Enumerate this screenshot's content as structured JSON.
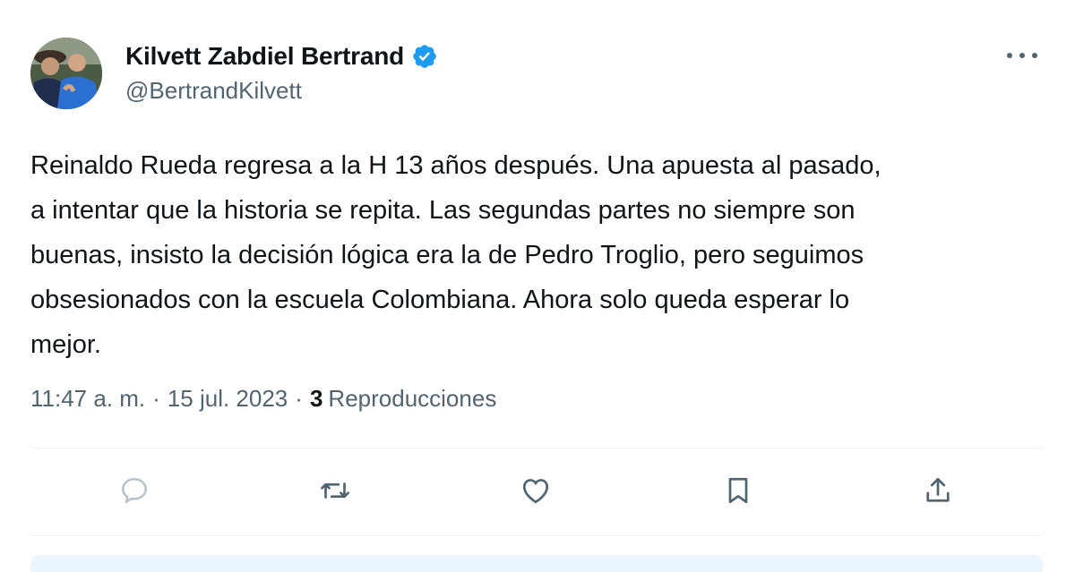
{
  "author": {
    "name": "Kilvett Zabdiel Bertrand",
    "handle": "@BertrandKilvett",
    "verified": true
  },
  "tweet": {
    "text": "Reinaldo Rueda regresa a la H 13 años después. Una apuesta al pasado,\na intentar que la historia se repita. Las segundas partes no siempre son\nbuenas, insisto la decisión lógica era la de Pedro Troglio, pero seguimos\nobsesionados con la escuela Colombiana. Ahora solo queda esperar lo\nmejor.",
    "time": "11:47 a. m.",
    "separator": "·",
    "date": "15 jul. 2023",
    "views_count": "3",
    "views_label": "Reproducciones"
  },
  "actions": [
    {
      "name": "reply",
      "icon": "reply-icon"
    },
    {
      "name": "retweet",
      "icon": "retweet-icon"
    },
    {
      "name": "like",
      "icon": "heart-icon"
    },
    {
      "name": "bookmark",
      "icon": "bookmark-icon"
    },
    {
      "name": "share",
      "icon": "share-icon"
    }
  ],
  "colors": {
    "text": "#0f1419",
    "secondary": "#536471",
    "verified": "#1d9bf0",
    "divider": "#eff3f4"
  }
}
